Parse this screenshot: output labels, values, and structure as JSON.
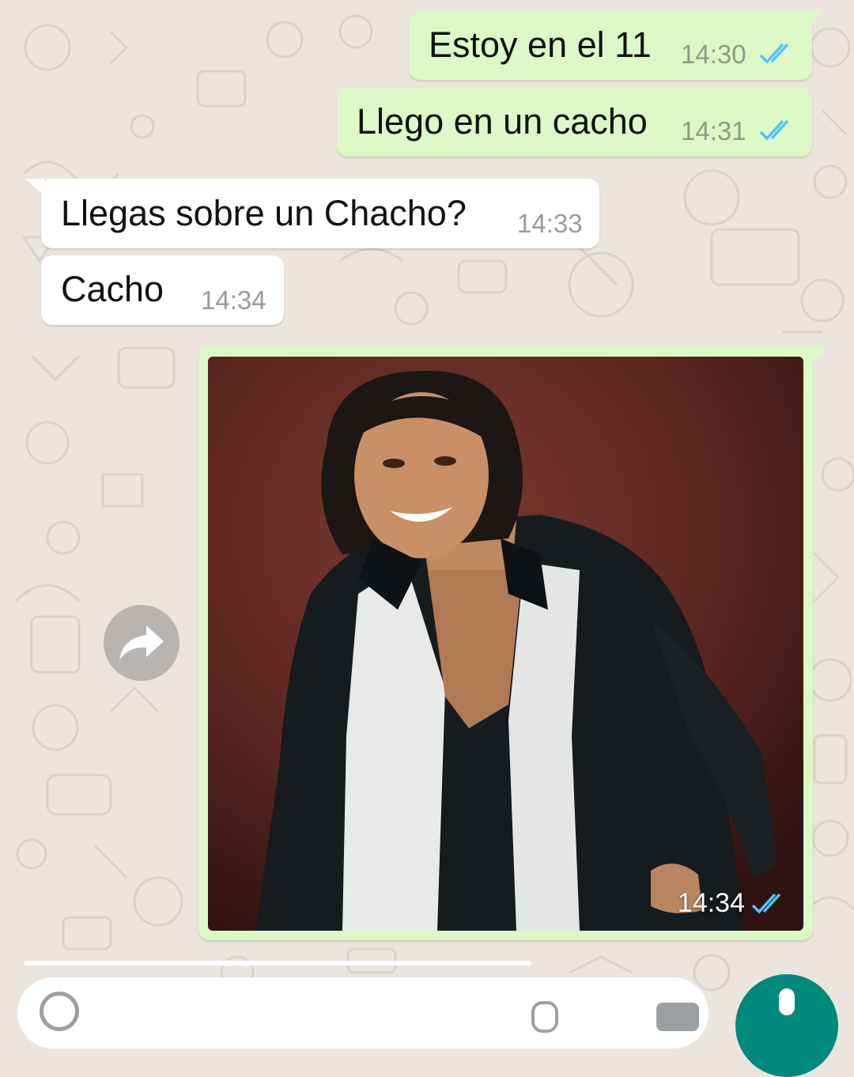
{
  "colors": {
    "wallpaper": "#ece5dd",
    "outgoing_bubble": "#dcf8c6",
    "incoming_bubble": "#ffffff",
    "read_ticks": "#4fc3f7",
    "accent": "#00897b"
  },
  "messages": [
    {
      "direction": "out",
      "text": "Estoy en el 11",
      "time": "14:30",
      "status": "read"
    },
    {
      "direction": "out",
      "text": "Llego en un cacho",
      "time": "14:31",
      "status": "read"
    },
    {
      "direction": "in",
      "text": "Llegas sobre un Chacho?",
      "time": "14:33"
    },
    {
      "direction": "in",
      "text": "Cacho",
      "time": "14:34"
    }
  ],
  "image_message": {
    "direction": "out",
    "time": "14:34",
    "status": "read",
    "subject": "portrait of a smiling man with dark shoulder-length hair wearing a black open-collar shirt over a white shirt"
  },
  "share_button": {
    "icon": "forward-arrow-icon"
  },
  "composer": {
    "icons": [
      "emoji-icon",
      "attach-icon",
      "camera-icon",
      "mic-icon"
    ]
  }
}
